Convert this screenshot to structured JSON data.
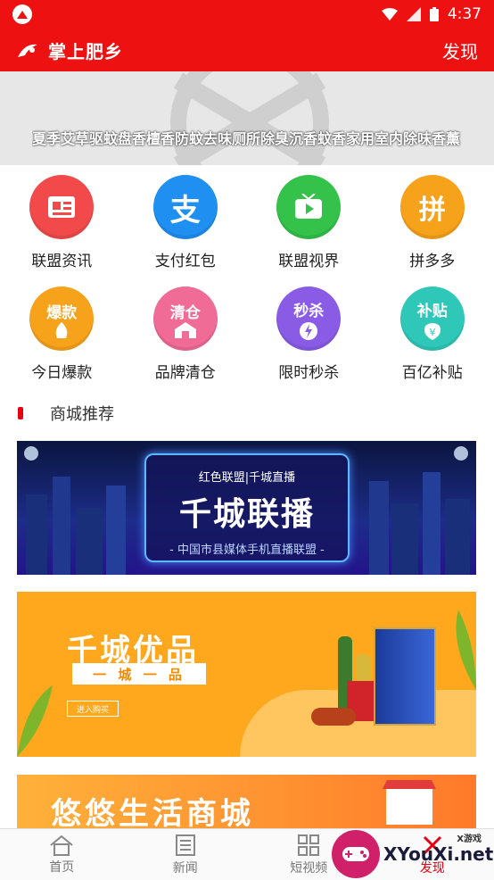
{
  "status_bar": {
    "time": "4:37"
  },
  "header": {
    "title": "掌上肥乡",
    "discover": "发现"
  },
  "banner": {
    "caption": "夏季艾草驱蚊盘香檀香防蚊去味厕所除臭沉香蚊香家用室内除味香薰"
  },
  "grid": [
    {
      "label": "联盟资讯",
      "icon": "news-icon",
      "color": "#f24a4a",
      "glyph": ""
    },
    {
      "label": "支付红包",
      "icon": "alipay-icon",
      "color": "#1f8ff2",
      "glyph": "支"
    },
    {
      "label": "联盟视界",
      "icon": "tv-icon",
      "color": "#34c24a",
      "glyph": ""
    },
    {
      "label": "拼多多",
      "icon": "pinduoduo-icon",
      "color": "#f7a21b",
      "glyph": "拼"
    },
    {
      "label": "今日爆款",
      "icon": "hot-deal-icon",
      "color": "#f7a21b",
      "glyph": "爆款"
    },
    {
      "label": "品牌清仓",
      "icon": "clearance-icon",
      "color": "#f06b96",
      "glyph": "清仓"
    },
    {
      "label": "限时秒杀",
      "icon": "flash-sale-icon",
      "color": "#8a5ce6",
      "glyph": "秒杀"
    },
    {
      "label": "百亿补贴",
      "icon": "subsidy-icon",
      "color": "#2fc7b8",
      "glyph": "补贴"
    }
  ],
  "section": {
    "title": "商城推荐"
  },
  "cards": {
    "live": {
      "top": "红色联盟|千城直播",
      "main": "千城联播",
      "bottom": "- 中国市县媒体手机直播联盟 -"
    },
    "youpin": {
      "title": "千城优品",
      "ribbon": "一 城 一 品",
      "button": "进入购买"
    },
    "shop": {
      "title": "悠悠生活商城"
    }
  },
  "bottom_nav": [
    {
      "label": "首页",
      "icon": "home-icon"
    },
    {
      "label": "新闻",
      "icon": "news-doc-icon"
    },
    {
      "label": "短视频",
      "icon": "grid-icon"
    },
    {
      "label": "发现",
      "icon": "discover-icon"
    }
  ],
  "watermark": {
    "text": "XYouXi.net",
    "small": "X游戏"
  }
}
